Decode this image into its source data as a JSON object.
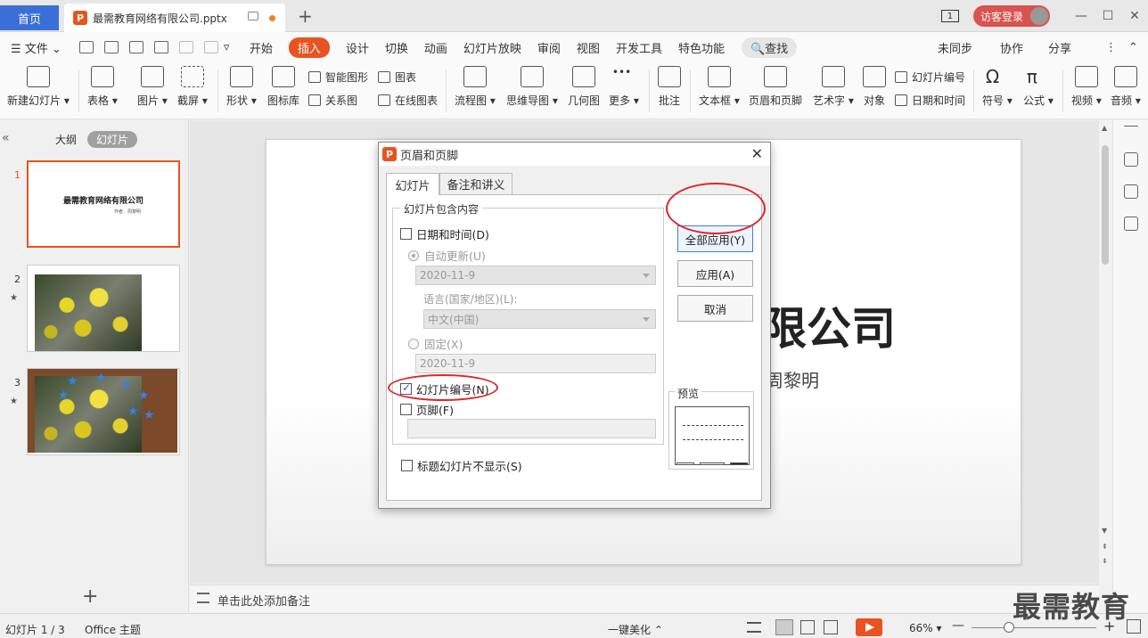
{
  "tabs": {
    "home": "首页",
    "doc_icon": "P",
    "doc_title": "最需教育网络有限公司.pptx",
    "new_tab": "+"
  },
  "topright": {
    "badge": "1",
    "login": "访客登录",
    "minimize": "—",
    "maximize": "☐",
    "close": "✕"
  },
  "menubar": {
    "file": "☰ 文件 ⌄",
    "items": [
      "开始",
      "插入",
      "设计",
      "切换",
      "动画",
      "幻灯片放映",
      "审阅",
      "视图",
      "开发工具",
      "特色功能"
    ],
    "active_index": 1,
    "search": "🔍查找",
    "sync": "未同步",
    "collab": "协作",
    "share": "分享",
    "more": "⋮",
    "collapse": "⌃"
  },
  "ribbon": {
    "new_slide": "新建幻灯片 ▾",
    "table": "表格 ▾",
    "picture": "图片 ▾",
    "screenshot": "截屏 ▾",
    "shape": "形状 ▾",
    "icon_lib": "图标库",
    "smart_shape": "智能图形",
    "relation": "关系图",
    "chart": "图表",
    "online_chart": "在线图表",
    "flowchart": "流程图 ▾",
    "mindmap": "思维导图 ▾",
    "geometry": "几何图",
    "more": "更多 ▾",
    "comment": "批注",
    "textbox": "文本框 ▾",
    "header_footer": "页眉和页脚",
    "wordart": "艺术字 ▾",
    "object": "对象",
    "slide_number": "幻灯片编号",
    "datetime": "日期和时间",
    "symbol": "符号 ▾",
    "formula": "公式 ▾",
    "video": "视频 ▾",
    "audio": "音频 ▾"
  },
  "leftpanel": {
    "collapse": "«",
    "outline": "大纲",
    "slides": "幻灯片",
    "thumb1_title": "最需教育网络有限公司",
    "thumb1_sub": "作者：周黎明",
    "numbers": [
      "1",
      "2",
      "3"
    ],
    "star": "★",
    "blue_star": "★",
    "add": "+"
  },
  "slide": {
    "title_partial": "限公司",
    "sub_partial": "周黎明"
  },
  "notes": {
    "placeholder": "单击此处添加备注"
  },
  "statusbar": {
    "slide_count": "幻灯片 1 / 3",
    "theme": "Office 主题",
    "beautify": "一键美化 ⌃",
    "zoom": "66% ▾",
    "minus": "—",
    "plus": "+"
  },
  "watermark": "最需教育",
  "dialog": {
    "icon": "P",
    "title": "页眉和页脚",
    "close": "✕",
    "tab_slides": "幻灯片",
    "tab_notes": "备注和讲义",
    "group_label": "幻灯片包含内容",
    "datetime": "日期和时间(D)",
    "auto_update": "自动更新(U)",
    "date_value": "2020-11-9",
    "language_label": "语言(国家/地区)(L):",
    "language_value": "中文(中国)",
    "fixed": "固定(X)",
    "fixed_value": "2020-11-9",
    "slide_number": "幻灯片编号(N)",
    "footer": "页脚(F)",
    "no_title_slide": "标题幻灯片不显示(S)",
    "apply_all": "全部应用(Y)",
    "apply": "应用(A)",
    "cancel": "取消",
    "preview": "预览"
  },
  "colors": {
    "accent": "#e8531f",
    "home_tab": "#3b6fd8",
    "annotation": "#e0242a"
  }
}
